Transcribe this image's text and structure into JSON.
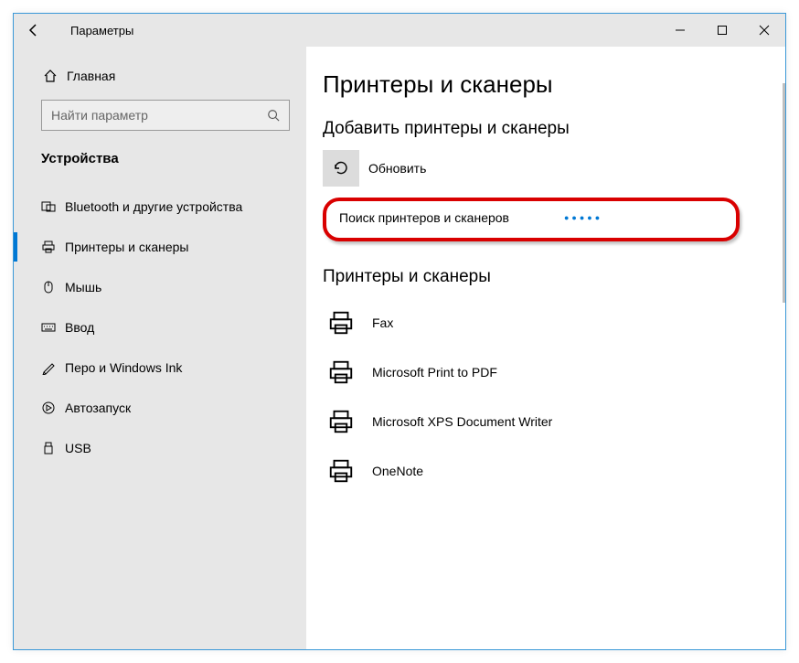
{
  "window": {
    "title": "Параметры"
  },
  "sidebar": {
    "home": "Главная",
    "search_placeholder": "Найти параметр",
    "section": "Устройства",
    "items": [
      {
        "label": "Bluetooth и другие устройства"
      },
      {
        "label": "Принтеры и сканеры"
      },
      {
        "label": "Мышь"
      },
      {
        "label": "Ввод"
      },
      {
        "label": "Перо и Windows Ink"
      },
      {
        "label": "Автозапуск"
      },
      {
        "label": "USB"
      }
    ]
  },
  "main": {
    "title": "Принтеры и сканеры",
    "add_heading": "Добавить принтеры и сканеры",
    "refresh": "Обновить",
    "searching": "Поиск принтеров и сканеров",
    "list_heading": "Принтеры и сканеры",
    "printers": [
      {
        "name": "Fax"
      },
      {
        "name": "Microsoft Print to PDF"
      },
      {
        "name": "Microsoft XPS Document Writer"
      },
      {
        "name": "OneNote"
      }
    ]
  }
}
